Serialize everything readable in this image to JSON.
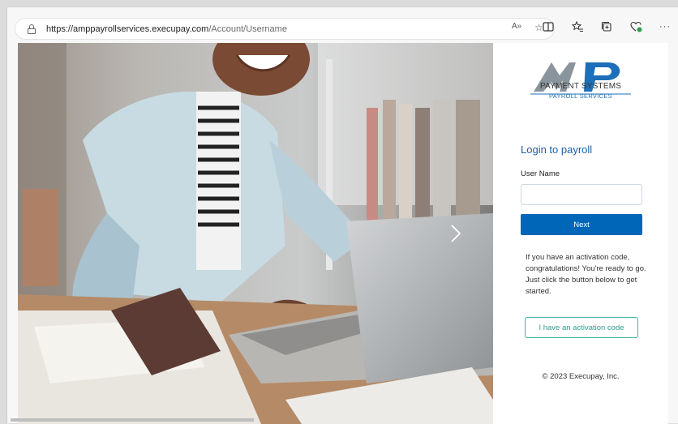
{
  "browser": {
    "url_prefix": "https://",
    "url_domain": "amppayrollservices.execupay.com",
    "url_path": "/Account/Username",
    "read_aloud_icon": "A»",
    "icons": [
      "read-aloud-icon",
      "favorite-star-icon",
      "split-screen-icon",
      "favorites-icon",
      "collections-icon",
      "extensions-icon",
      "more-icon"
    ]
  },
  "logo": {
    "mark": "AMP",
    "line1": "PAYMENT SYSTEMS",
    "line2": "PAYROLL SERVICES"
  },
  "login": {
    "title": "Login to payroll",
    "username_label": "User Name",
    "username_value": "",
    "next_label": "Next",
    "activation_text": "If you have an activation code, congratulations! You're ready to go. Just click the button below to get started.",
    "activation_button": "I have an activation code",
    "copyright": "© 2023 Execupay, Inc."
  },
  "colors": {
    "brand_blue": "#0067b8",
    "title_blue": "#1f5fa8",
    "teal": "#2f9e8b",
    "logo_gray": "#8a949c",
    "logo_blue": "#1c6fb8"
  }
}
